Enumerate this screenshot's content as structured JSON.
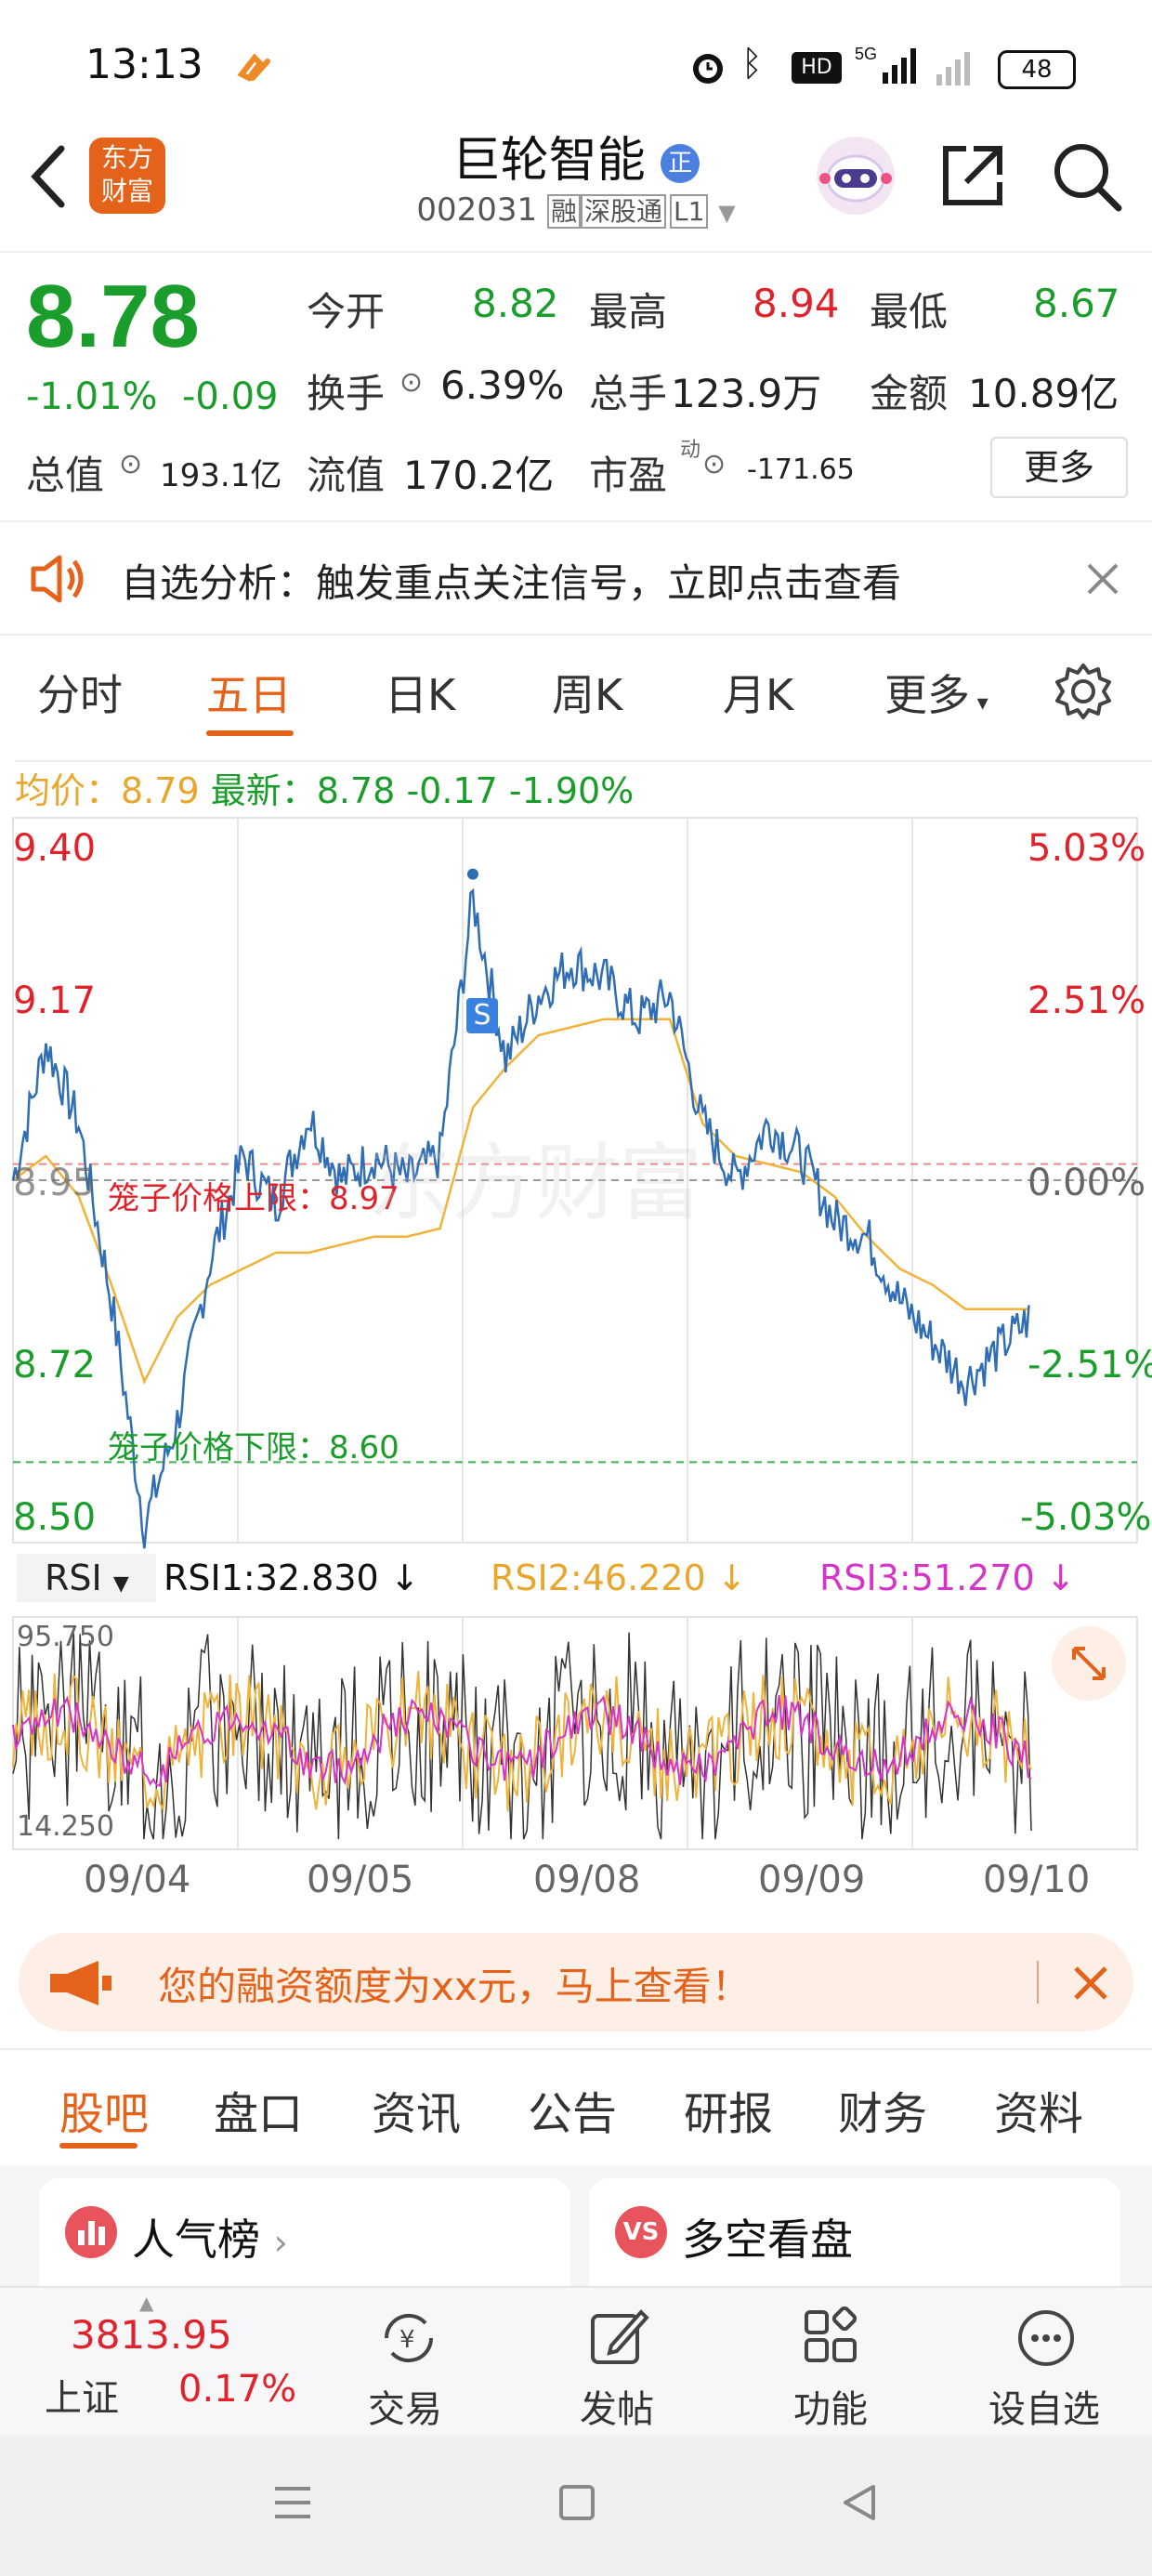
{
  "status_bar": {
    "time": "13:13",
    "battery": "48",
    "icons": [
      "alarm-icon",
      "bluetooth-icon",
      "hd-icon",
      "signal-5g-icon",
      "signal-icon",
      "battery-icon"
    ]
  },
  "header": {
    "brand_line1": "东方",
    "brand_line2": "财富",
    "stock_name": "巨轮智能",
    "badge": "正",
    "code": "002031",
    "tag1": "融",
    "tag2": "深股通",
    "tag3": "L1"
  },
  "quote": {
    "price": "8.78",
    "change_pct": "-1.01%",
    "change": "-0.09",
    "open_label": "今开",
    "open": "8.82",
    "high_label": "最高",
    "high": "8.94",
    "low_label": "最低",
    "low": "8.67",
    "turnover_label": "换手",
    "turnover": "6.39%",
    "volume_label": "总手",
    "volume": "123.9万",
    "amount_label": "金额",
    "amount": "10.89亿",
    "mktcap_label": "总值",
    "mktcap": "193.1亿",
    "float_label": "流值",
    "float": "170.2亿",
    "pe_label": "市盈",
    "pe_sup": "动",
    "pe": "-171.65",
    "more": "更多"
  },
  "notice": {
    "label": "自选分析：",
    "text": "触发重点关注信号，立即点击查看"
  },
  "tabs": [
    "分时",
    "五日",
    "日K",
    "周K",
    "月K",
    "更多"
  ],
  "chart_info": {
    "avg_label": "均价：",
    "avg": "8.79",
    "latest_label": "最新：",
    "latest": "8.78",
    "latest_chg": "-0.17",
    "latest_pct": "-1.90%",
    "upper_limit_label": "笼子价格上限：8.97",
    "lower_limit_label": "笼子价格下限：8.60",
    "s_marker": "S",
    "watermark": "东方财富"
  },
  "chart_data": {
    "type": "line",
    "x": [
      "09/04",
      "09/05",
      "09/08",
      "09/09",
      "09/10"
    ],
    "ylim": [
      8.5,
      9.4
    ],
    "ytick_labels_left": [
      "9.40",
      "9.17",
      "8.95",
      "8.72",
      "8.50"
    ],
    "ytick_labels_right": [
      "5.03%",
      "2.51%",
      "0.00%",
      "-2.51%",
      "-5.03%"
    ],
    "series": [],
    "reference_lines": [
      8.97,
      8.95,
      8.6
    ],
    "approx_path": {
      "price": [
        8.95,
        9.12,
        9.02,
        8.8,
        8.52,
        8.65,
        8.85,
        8.98,
        8.92,
        9.03,
        8.95,
        8.98,
        8.95,
        8.98,
        9.3,
        9.1,
        9.18,
        9.22,
        9.2,
        9.15,
        9.18,
        9.02,
        8.95,
        9.02,
        8.98,
        8.9,
        8.88,
        8.8,
        8.75,
        8.7,
        8.74,
        8.78
      ],
      "avg": [
        8.95,
        8.98,
        8.93,
        8.82,
        8.7,
        8.78,
        8.82,
        8.84,
        8.86,
        8.86,
        8.87,
        8.88,
        8.88,
        8.89,
        9.04,
        9.09,
        9.13,
        9.14,
        9.15,
        9.15,
        9.15,
        9.02,
        8.98,
        8.97,
        8.96,
        8.93,
        8.88,
        8.84,
        8.82,
        8.79,
        8.79,
        8.79
      ]
    },
    "rsi": {
      "label": "RSI",
      "rsi1": "RSI1:32.830",
      "rsi2": "RSI2:46.220",
      "rsi3": "RSI3:51.270",
      "ymax_label": "95.750",
      "ymin_label": "14.250",
      "ylim": [
        14.25,
        95.75
      ]
    }
  },
  "promo": {
    "text": "您的融资额度为xx元，马上查看！"
  },
  "bottom_tabs": [
    "股吧",
    "盘口",
    "资讯",
    "公告",
    "研报",
    "财务",
    "资料"
  ],
  "cards": [
    "人气榜",
    "多空看盘"
  ],
  "bottom_nav": {
    "index_value": "3813.95",
    "index_name": "上证",
    "index_pct": "0.17%",
    "items": [
      "交易",
      "发帖",
      "功能",
      "设自选"
    ]
  },
  "colors": {
    "up": "#e0222b",
    "down": "#1b9d2c",
    "accent": "#e4621a",
    "price_line": "#2f6db5",
    "avg_line": "#f0b33a",
    "rsi3": "#d633c9"
  }
}
